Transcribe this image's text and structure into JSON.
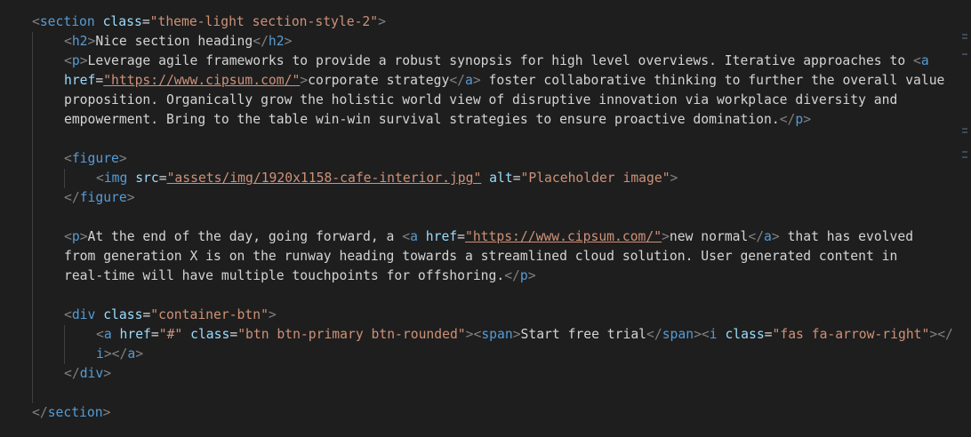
{
  "code": {
    "section_tag": "section",
    "section_class_attr": "class",
    "section_class_val": "\"theme-light section-style-2\"",
    "h2_tag": "h2",
    "h2_text": "Nice section heading",
    "p_tag": "p",
    "p1_text_a": "Leverage agile frameworks to provide a robust synopsis for high level overviews. Iterative approaches to ",
    "a_tag": "a",
    "href_attr": "href",
    "url": "\"https://www.cipsum.com/\"",
    "p1_link_text": "corporate strategy",
    "p1_text_b": " foster collaborative thinking to further the overall value",
    "p1_line3": "proposition. Organically grow the holistic world view of disruptive innovation via workplace diversity and",
    "p1_line4": "empowerment. Bring to the table win-win survival strategies to ensure proactive domination.",
    "figure_tag": "figure",
    "img_tag": "img",
    "src_attr": "src",
    "src_val": "\"assets/img/1920x1158-cafe-interior.jpg\"",
    "alt_attr": "alt",
    "alt_val": "\"Placeholder image\"",
    "p2_text_a": "At the end of the day, going forward, a ",
    "p2_link_text": "new normal",
    "p2_text_b": " that has evolved",
    "p2_line2": "from generation X is on the runway heading towards a streamlined cloud solution. User generated content in",
    "p2_line3": "real-time will have multiple touchpoints for offshoring.",
    "div_tag": "div",
    "div_class_val": "\"container-btn\"",
    "btn_href_val": "\"#\"",
    "btn_class_val": "\"btn btn-primary btn-rounded\"",
    "span_tag": "span",
    "btn_text": "Start free trial",
    "i_tag": "i",
    "icon_class_val": "\"fas fa-arrow-right\"",
    "i_tag_wrap": "i"
  }
}
